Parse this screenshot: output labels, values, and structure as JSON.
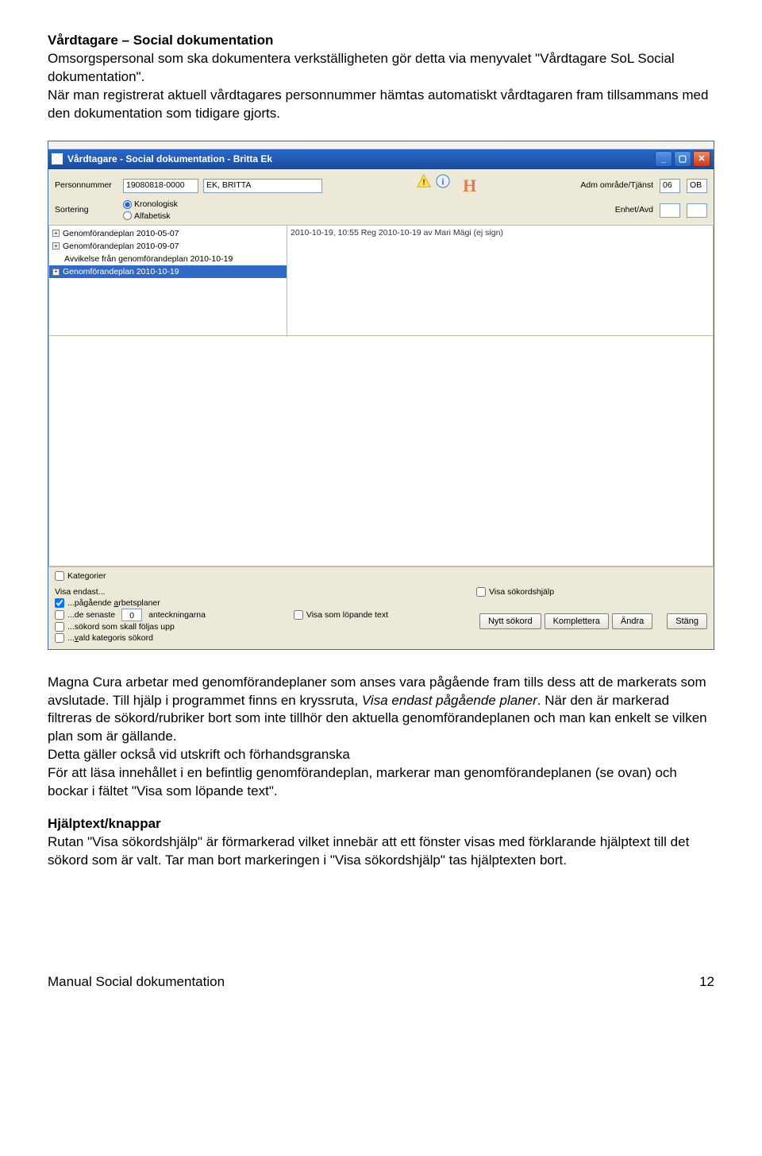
{
  "doc": {
    "heading": "Vårdtagare – Social dokumentation",
    "para1": "Omsorgspersonal som ska dokumentera verkställigheten gör detta via menyvalet \"Vårdtagare SoL Social dokumentation\".",
    "para2": "När man registrerat aktuell vårdtagares personnummer hämtas automatiskt vårdtagaren fram tillsammans med den dokumentation som tidigare gjorts.",
    "para3a": "Magna Cura arbetar med genomförandeplaner som anses vara pågående fram tills dess att de markerats som avslutade. Till hjälp i programmet finns en kryssruta, ",
    "para3b": "Visa endast pågående planer",
    "para3c": ". När den är markerad filtreras de sökord/rubriker bort som inte tillhör den aktuella genomförandeplanen och man kan enkelt se vilken plan som är gällande.",
    "para4": "Detta gäller också vid utskrift och förhandsgranska",
    "para5": "För att läsa innehållet i en befintlig genomförandeplan, markerar man genomförandeplanen (se ovan) och bockar i fältet \"Visa som löpande text\".",
    "help_heading": "Hjälptext/knappar",
    "para6": "Rutan \"Visa sökordshjälp\" är förmarkerad vilket innebär att ett fönster visas med förklarande hjälptext till det sökord som är valt. Tar man bort markeringen i \"Visa sökordshjälp\" tas hjälptexten bort.",
    "footer_center": "Manual Social dokumentation",
    "footer_page": "12"
  },
  "win": {
    "title": "Vårdtagare - Social dokumentation - Britta Ek",
    "personnummer_lbl": "Personnummer",
    "personnummer_val": "19080818-0000",
    "name_val": "EK, BRITTA",
    "sortering_lbl": "Sortering",
    "sort_krono": "Kronologisk",
    "sort_alfa": "Alfabetisk",
    "adm_lbl": "Adm område/Tjänst",
    "adm_val1": "06",
    "adm_val2": "OB",
    "enhet_lbl": "Enhet/Avd",
    "h_letter": "H",
    "tree_items": [
      "Genomförandeplan  2010-05-07",
      "Genomförandeplan  2010-09-07",
      "Avvikelse från  genomförandeplan  2010-10-19",
      "Genomförandeplan  2010-10-19"
    ],
    "tree_right": "2010-10-19, 10:55        Reg 2010-10-19 av Mari Mägi (ej sign)",
    "kategorier": "Kategorier",
    "visa_endast": "Visa endast...",
    "chk_pagaende": "...pågående arbetsplaner",
    "chk_senaste_pre": "...de senaste",
    "chk_senaste_num": "0",
    "chk_senaste_post": "anteckningarna",
    "chk_sokord_folj": "...sökord som skall följas upp",
    "chk_vald_kategori": "...vald kategoris sökord",
    "chk_lopande": "Visa som löpande text",
    "chk_sokordshjalp": "Visa sökordshjälp",
    "btn_nytt": "Nytt sökord",
    "btn_komplettera": "Komplettera",
    "btn_andra": "Ändra",
    "btn_stang": "Stäng"
  }
}
